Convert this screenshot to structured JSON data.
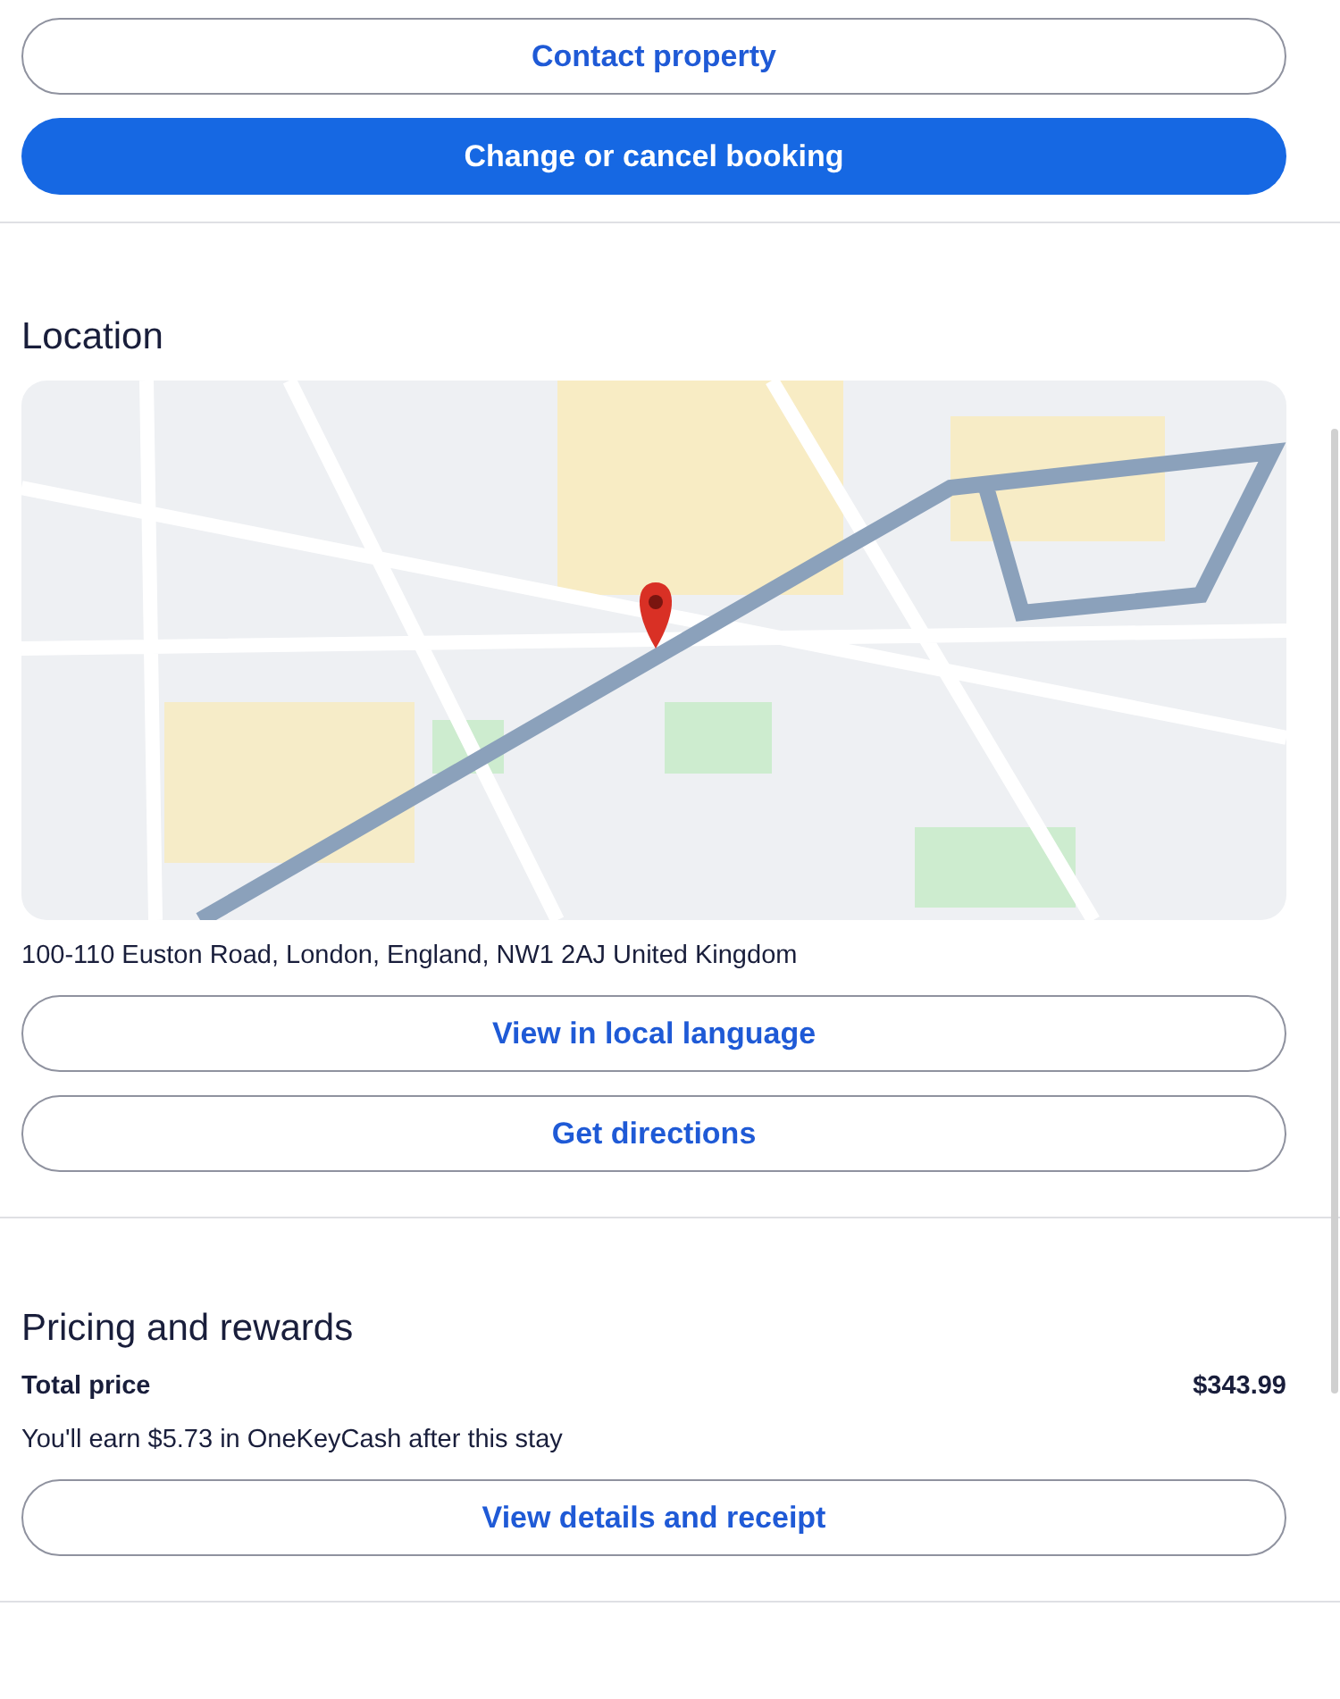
{
  "actions": {
    "buttons": [
      {
        "label": "Contact property",
        "kind": "outline"
      },
      {
        "label": "Change or cancel booking",
        "kind": "primary"
      }
    ]
  },
  "location": {
    "title": "Location",
    "address": "100-110 Euston Road, London, England, NW1 2AJ United Kingdom",
    "buttons": [
      {
        "label": "View in local language",
        "kind": "outline"
      },
      {
        "label": "Get directions",
        "kind": "outline"
      }
    ]
  },
  "pricing": {
    "title": "Pricing and rewards",
    "total_label": "Total price",
    "total_value": "$343.99",
    "rewards": "You'll earn $5.73 in OneKeyCash after this stay",
    "buttons": [
      {
        "label": "View details and receipt",
        "kind": "outline"
      }
    ]
  }
}
